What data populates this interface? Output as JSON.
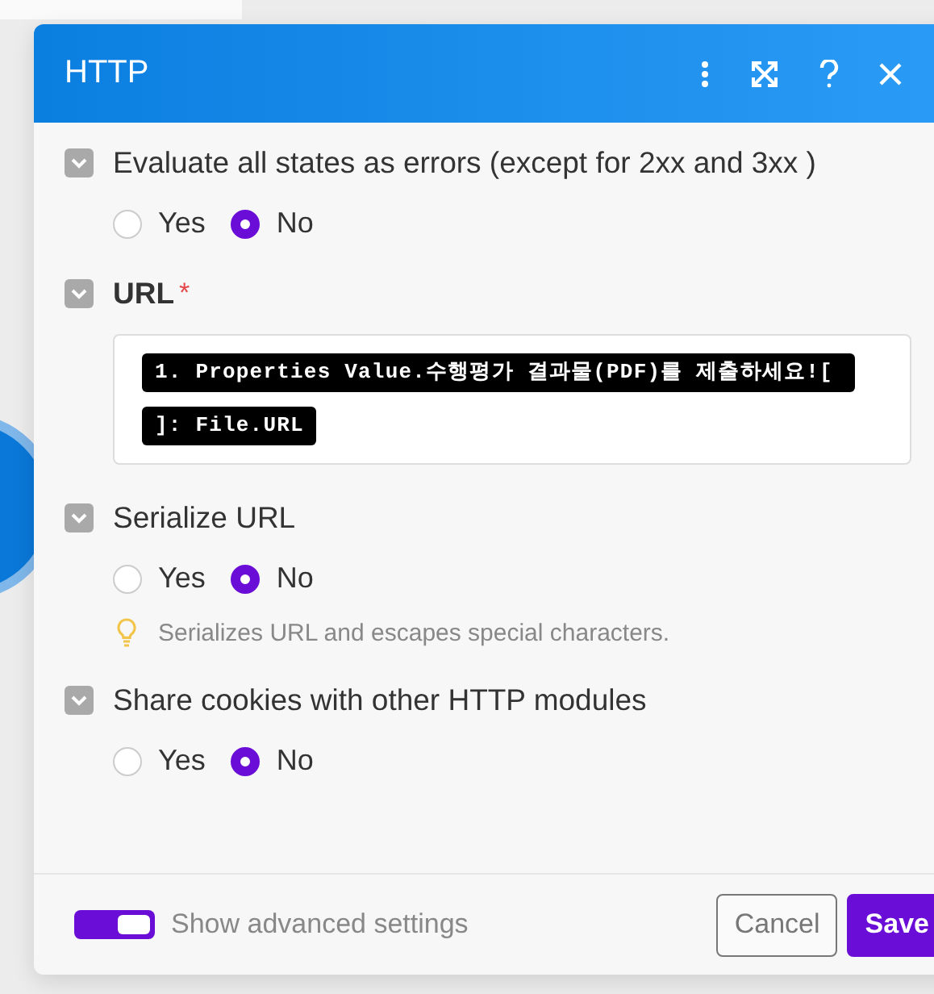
{
  "dialog": {
    "title": "HTTP"
  },
  "sections": [
    {
      "kind": "radio",
      "label": "Evaluate all states as errors (except for 2xx and 3xx )",
      "options": [
        {
          "label": "Yes",
          "selected": false
        },
        {
          "label": "No",
          "selected": true
        }
      ]
    },
    {
      "kind": "mapping",
      "label": "URL",
      "required_mark": "*",
      "tokens": [
        "1. Properties Value.수행평가 결과물(PDF)를 제출하세요![",
        "]: File.URL"
      ]
    },
    {
      "kind": "radio",
      "label": "Serialize URL",
      "options": [
        {
          "label": "Yes",
          "selected": false
        },
        {
          "label": "No",
          "selected": true
        }
      ],
      "hint": "Serializes URL and escapes special characters."
    },
    {
      "kind": "radio",
      "label": "Share cookies with other HTTP modules",
      "options": [
        {
          "label": "Yes",
          "selected": false
        },
        {
          "label": "No",
          "selected": true
        }
      ]
    }
  ],
  "footer": {
    "advanced": {
      "label": "Show advanced settings",
      "on": true
    },
    "buttons": [
      {
        "label": "Cancel",
        "kind": "secondary"
      },
      {
        "label": "Save",
        "kind": "primary"
      }
    ]
  }
}
